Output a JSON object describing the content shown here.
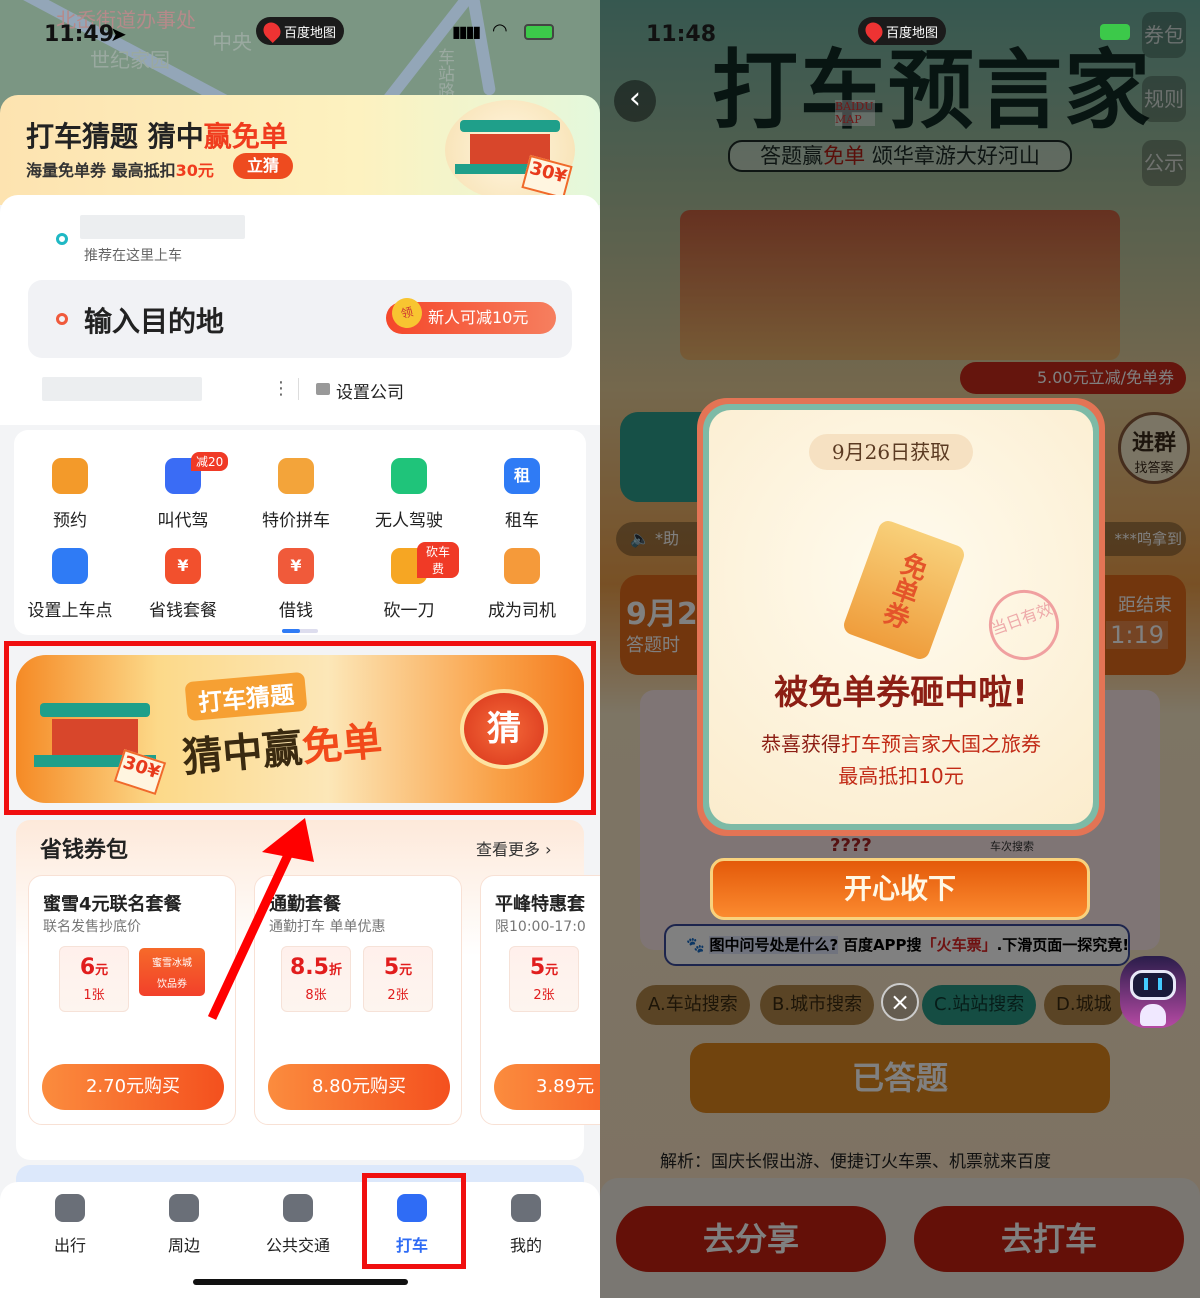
{
  "left": {
    "status": {
      "time": "11:49",
      "app_pill": "百度地图"
    },
    "map_labels": [
      "北岙街道办事处",
      "世纪家园",
      "中央",
      "车站路"
    ],
    "promo": {
      "title_a": "打车猜题 猜中",
      "title_b": "赢免单",
      "sub_a": "海量免单券 最高抵扣",
      "sub_b": "30元",
      "button": "立猜",
      "badge": "30¥"
    },
    "pickup": {
      "hint": "推荐在这里上车"
    },
    "destination": {
      "placeholder": "输入目的地",
      "newbie_badge": "新人可减10元",
      "coin": "领"
    },
    "shortcut": {
      "company": "设置公司"
    },
    "services": [
      {
        "label": "预约",
        "icon": "clock-icon",
        "color": "#f39a2a"
      },
      {
        "label": "叫代驾",
        "icon": "driver-icon",
        "color": "#3a6cf5",
        "badge": "减20"
      },
      {
        "label": "特价拼车",
        "icon": "carpool-icon",
        "color": "#f3a43a"
      },
      {
        "label": "无人驾驶",
        "icon": "robotaxi-icon",
        "color": "#1fc47a"
      },
      {
        "label": "租车",
        "icon": "rent-car-icon",
        "color": "#2f7bf5",
        "glyph": "租"
      },
      {
        "label": "设置上车点",
        "icon": "pickup-point-icon",
        "color": "#2f7bf5"
      },
      {
        "label": "省钱套餐",
        "icon": "yuan-package-icon",
        "color": "#f2502d",
        "glyph": "¥"
      },
      {
        "label": "借钱",
        "icon": "money-bag-icon",
        "color": "#f05a3a",
        "glyph": "¥"
      },
      {
        "label": "砍一刀",
        "icon": "cut-icon",
        "color": "#f6a623",
        "badge": "砍车费"
      },
      {
        "label": "成为司机",
        "icon": "become-driver-icon",
        "color": "#f59a3a"
      }
    ],
    "banner": {
      "line1": "打车猜题",
      "line2a": "猜中赢",
      "line2b": "免单",
      "button": "猜",
      "badge": "30¥"
    },
    "coupons": {
      "title": "省钱券包",
      "more": "查看更多",
      "items": [
        {
          "name": "蜜雪4元联名套餐",
          "desc": "联名发售抄底价",
          "tiles": [
            {
              "value": "6",
              "unit": "元",
              "count": "1张"
            }
          ],
          "brand_tile": {
            "brand": "蜜雪冰城",
            "type": "饮品券"
          },
          "buy": "2.70元购买"
        },
        {
          "name": "通勤套餐",
          "desc": "通勤打车 单单优惠",
          "tiles": [
            {
              "value": "8.5",
              "unit": "折",
              "count": "8张"
            },
            {
              "value": "5",
              "unit": "元",
              "count": "2张"
            }
          ],
          "buy": "8.80元购买"
        },
        {
          "name": "平峰特惠套",
          "desc": "限10:00-17:0",
          "tiles": [
            {
              "value": "5",
              "unit": "元",
              "count": "2张"
            }
          ],
          "buy": "3.89元"
        }
      ]
    },
    "nav": [
      {
        "label": "出行",
        "icon": "travel-icon"
      },
      {
        "label": "周边",
        "icon": "nearby-icon"
      },
      {
        "label": "公共交通",
        "icon": "bus-icon"
      },
      {
        "label": "打车",
        "icon": "taxi-icon",
        "active": true
      },
      {
        "label": "我的",
        "icon": "profile-icon"
      }
    ],
    "accent": "#f03c1e",
    "highlight_color": "#f00f0f"
  },
  "right": {
    "status": {
      "time": "11:48",
      "app_pill": "百度地图"
    },
    "header": {
      "title": "打车预言家",
      "logo": "BAIDU MAP",
      "slogan_a": "答题赢",
      "slogan_b": "免单",
      "slogan_c": " 颂华章游大好河山"
    },
    "side_buttons": [
      "券包",
      "规则",
      "公示"
    ],
    "background_texts": {
      "join_group_a": "进群",
      "join_group_b": "找答案",
      "ticker_left": "*助",
      "ticker_right": "***鸣拿到",
      "banner": "5.00元立减/免单券",
      "countdown_label": "距结束",
      "countdown": "1:19",
      "date_partial": "9月2",
      "answer_time": "答题时",
      "question_marks": "????",
      "train_search": "车次搜索"
    },
    "hint": {
      "q": "图中问号处是什么?",
      "a": "百度APP搜",
      "kw": "「火车票」",
      "b": ".下滑页面一探究竟!"
    },
    "options": [
      "A.车站搜索",
      "B.城市搜索",
      "C.站站搜索",
      "D.城城"
    ],
    "answered": "已答题",
    "analysis": "解析：国庆长假出游、便捷订火车票、机票就来百度",
    "bottom_buttons": [
      "去分享",
      "去打车"
    ],
    "modal": {
      "date": "9月26日获取",
      "ticket": "免单券",
      "stamp": "当日有效",
      "title": "被免单券砸中啦!",
      "desc_a": "恭喜获得",
      "desc_b": "打车预言家大国之旅券",
      "desc_c": "最高抵扣10元",
      "accept": "开心收下",
      "close": "×"
    }
  }
}
